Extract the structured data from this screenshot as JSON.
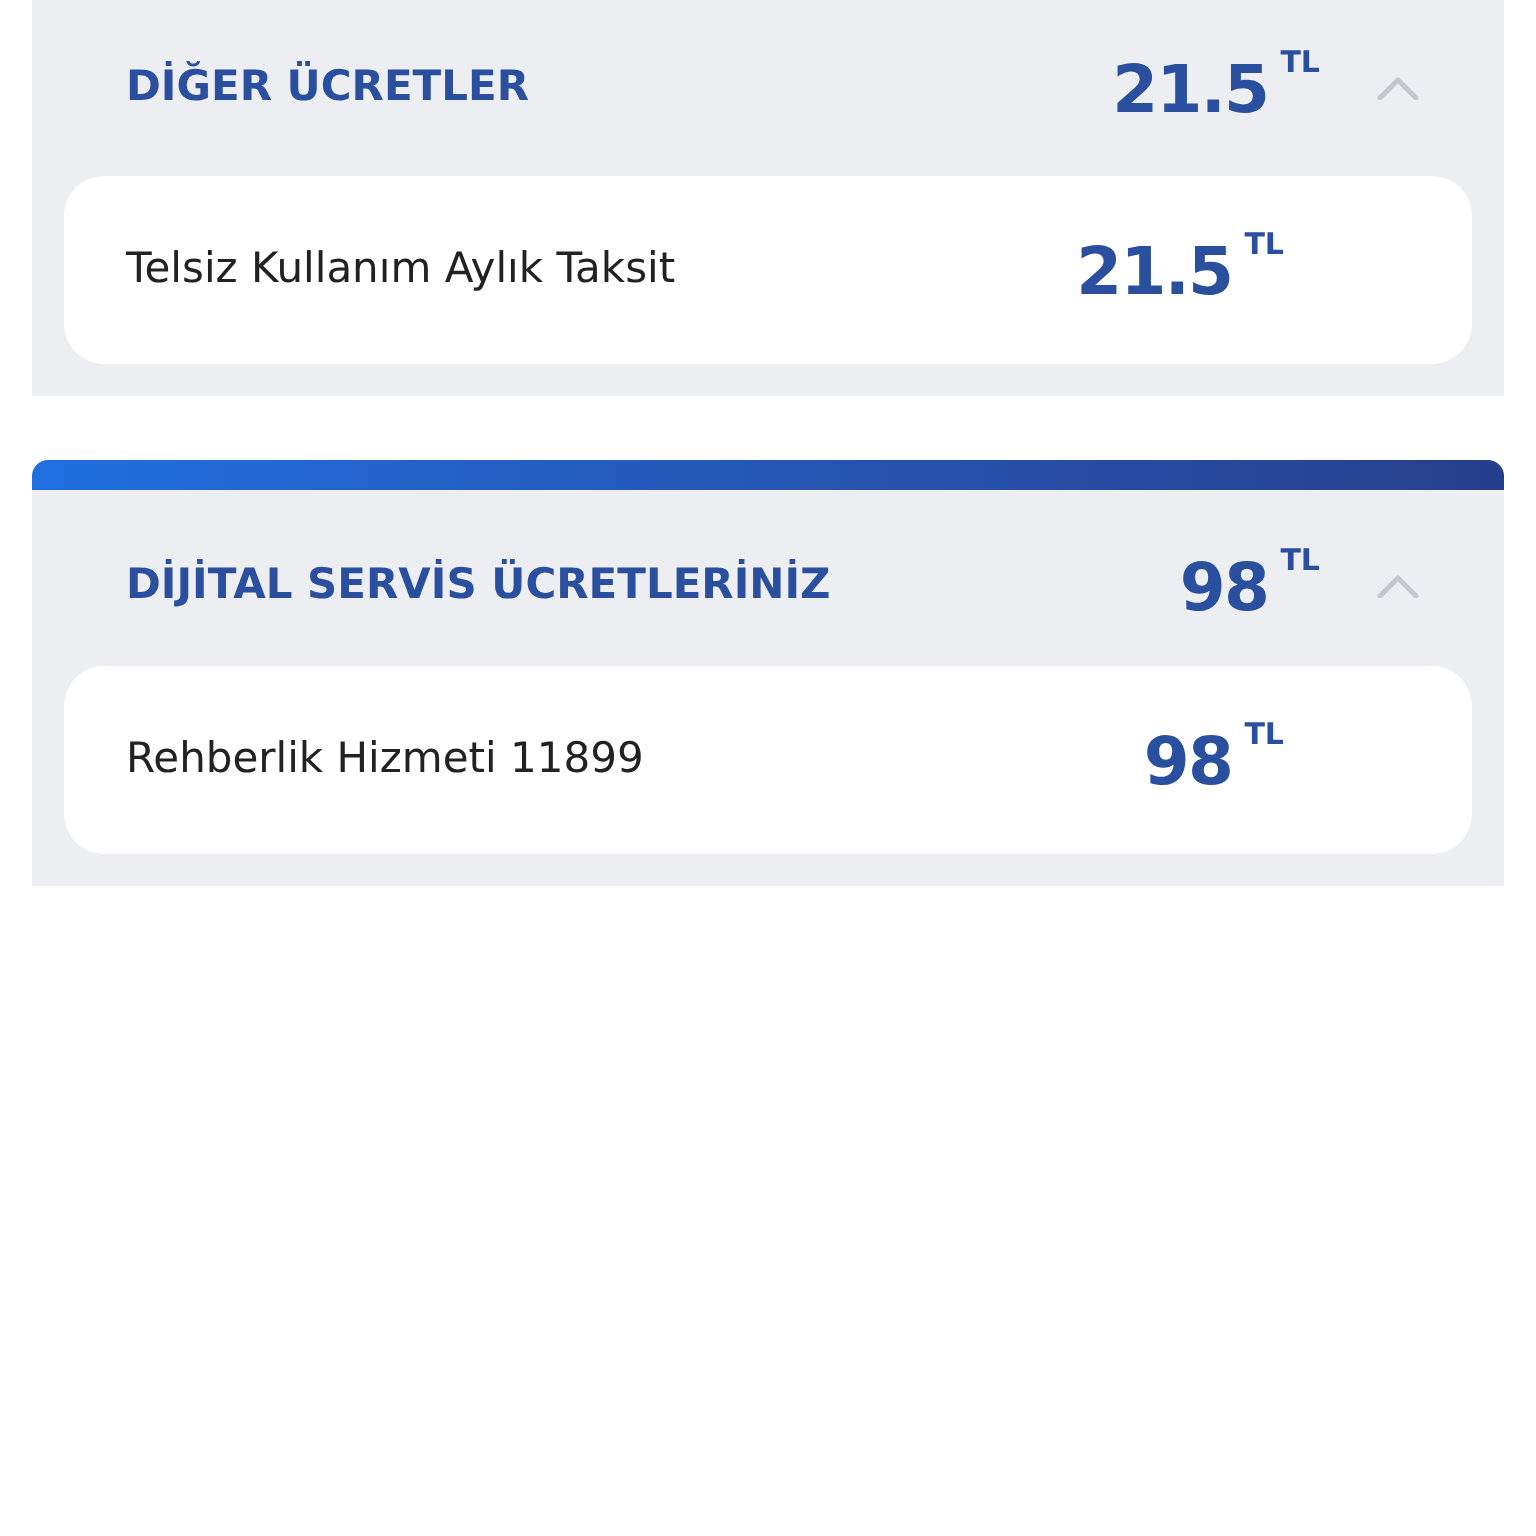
{
  "sections": [
    {
      "title": "DİĞER ÜCRETLER",
      "amount": "21.5",
      "currency": "TL",
      "expanded": true,
      "top_bar": false,
      "items": [
        {
          "label": "Telsiz Kullanım Aylık Taksit",
          "amount": "21.5",
          "currency": "TL"
        }
      ]
    },
    {
      "title": "DİJİTAL SERVİS ÜCRETLERİNİZ",
      "amount": "98",
      "currency": "TL",
      "expanded": true,
      "top_bar": true,
      "items": [
        {
          "label": "Rehberlik Hizmeti 11899",
          "amount": "98",
          "currency": "TL"
        }
      ]
    }
  ]
}
